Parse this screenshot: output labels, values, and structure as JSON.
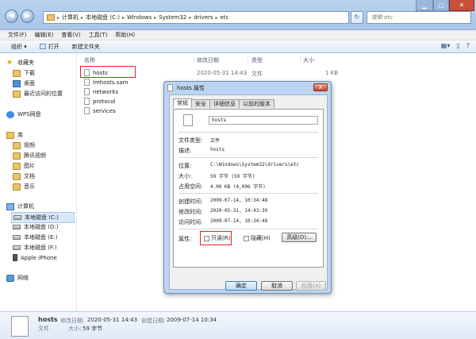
{
  "window": {
    "nav_back": "◀",
    "nav_forward": "▶",
    "address": [
      "计算机",
      "本地磁盘 (C:)",
      "Windows",
      "System32",
      "drivers",
      "etc"
    ],
    "refresh": "↻",
    "search_placeholder": "搜索 etc"
  },
  "menu": [
    "文件(F)",
    "编辑(E)",
    "查看(V)",
    "工具(T)",
    "帮助(H)"
  ],
  "toolbar": {
    "organize": "组织 ▾",
    "open": "打开",
    "new_folder": "新建文件夹"
  },
  "sidebar": {
    "favorites": "收藏夹",
    "fav_items": [
      "下载",
      "桌面",
      "最近访问的位置"
    ],
    "wps": "WPS网盘",
    "libraries": "库",
    "lib_items": [
      "视频",
      "腾讯视频",
      "图片",
      "文档",
      "音乐"
    ],
    "computer": "计算机",
    "drives": [
      "本地磁盘 (C:)",
      "本地磁盘 (D:)",
      "本地磁盘 (E:)",
      "本地磁盘 (F:)",
      "Apple iPhone"
    ],
    "network": "网络"
  },
  "columns": {
    "name": "名称",
    "date": "修改日期",
    "type": "类型",
    "size": "大小"
  },
  "files": [
    {
      "name": "hosts",
      "date": "2020-05-31 14:43",
      "type": "文件",
      "size": "1 KB"
    },
    {
      "name": "lmhosts.sam",
      "date": "",
      "type": "",
      "size": ""
    },
    {
      "name": "networks",
      "date": "",
      "type": "",
      "size": ""
    },
    {
      "name": "protocol",
      "date": "",
      "type": "",
      "size": ""
    },
    {
      "name": "services",
      "date": "",
      "type": "",
      "size": ""
    }
  ],
  "status": {
    "name": "hosts",
    "modified_label": "修改日期:",
    "modified": "2020-05-31 14:43",
    "created_label": "创建日期:",
    "created": "2009-07-14 10:34",
    "type": "文件",
    "size_label": "大小:",
    "size": "59 字节"
  },
  "dialog": {
    "title": "hosts 属性",
    "close": "X",
    "tabs": [
      "常规",
      "安全",
      "详细信息",
      "以前的版本"
    ],
    "filename": "hosts",
    "rows1": [
      {
        "label": "文件类型:",
        "value": "文件"
      },
      {
        "label": "描述:",
        "value": "hosts"
      }
    ],
    "rows2": [
      {
        "label": "位置:",
        "value": "C:\\Windows\\System32\\drivers\\etc"
      },
      {
        "label": "大小:",
        "value": "59 字节 (59 字节)"
      },
      {
        "label": "占用空间:",
        "value": "4.00 KB (4,096 字节)"
      }
    ],
    "rows3": [
      {
        "label": "创建时间:",
        "value": "2009-07-14, 10:34:48"
      },
      {
        "label": "修改时间:",
        "value": "2020-05-31, 14:43:39"
      },
      {
        "label": "访问时间:",
        "value": "2009-07-14, 10:34:48"
      }
    ],
    "attr_label": "属性:",
    "readonly": "只读(R)",
    "hidden": "隐藏(H)",
    "advanced": "高级(D)...",
    "ok": "确定",
    "cancel": "取消",
    "apply": "应用(A)"
  }
}
